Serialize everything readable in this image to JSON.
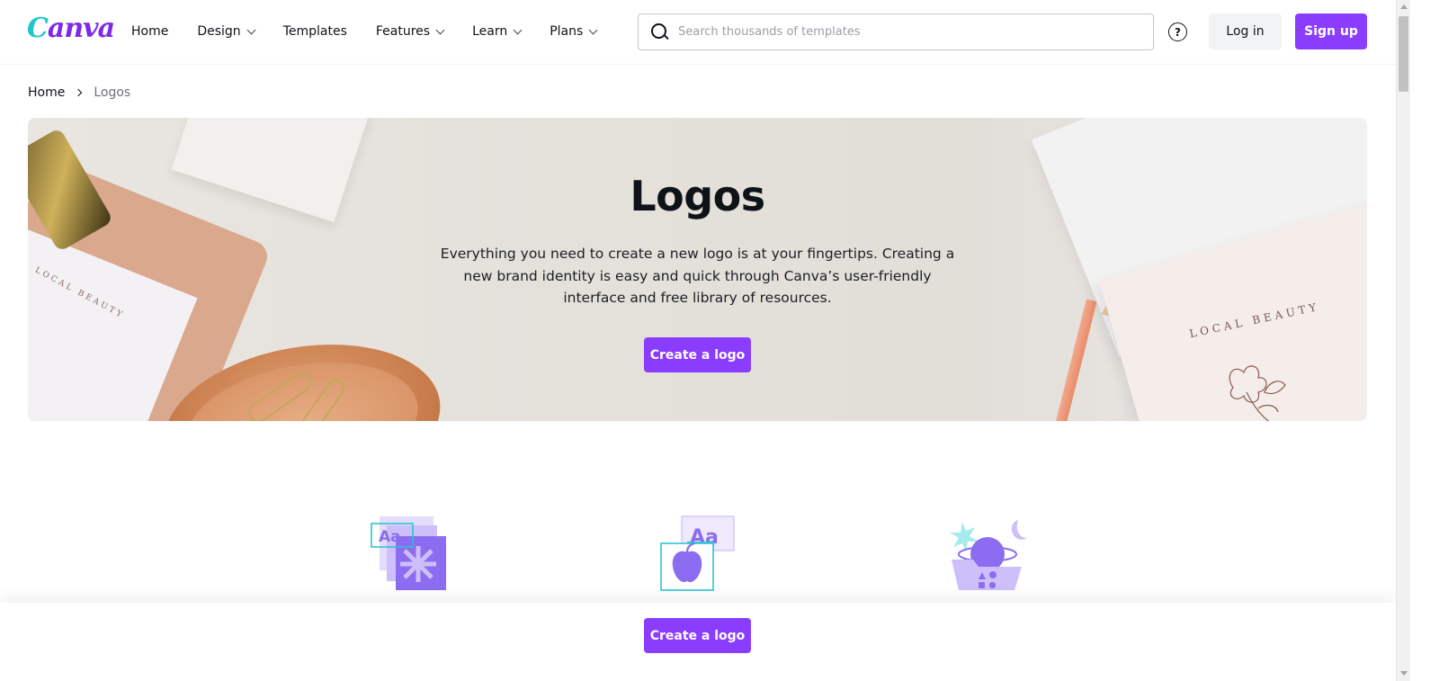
{
  "header": {
    "brand": "Canva",
    "nav": [
      {
        "label": "Home",
        "has_dropdown": false
      },
      {
        "label": "Design",
        "has_dropdown": true
      },
      {
        "label": "Templates",
        "has_dropdown": false
      },
      {
        "label": "Features",
        "has_dropdown": true
      },
      {
        "label": "Learn",
        "has_dropdown": true
      },
      {
        "label": "Plans",
        "has_dropdown": true
      }
    ],
    "search": {
      "placeholder": "Search thousands of templates",
      "value": ""
    },
    "help_glyph": "?",
    "login_label": "Log in",
    "signup_label": "Sign up"
  },
  "breadcrumb": {
    "home": "Home",
    "current": "Logos"
  },
  "hero": {
    "title": "Logos",
    "description": "Everything you need to create a new logo is at your fingertips. Creating a new brand identity is easy and quick through Canva’s user-friendly interface and free library of resources.",
    "cta_label": "Create a logo",
    "emblem_text": "LOCAL BEAUTY",
    "emblem_left_text": "LOCAL BEAUTY"
  },
  "features": {
    "icons": [
      "typography-layers-icon",
      "brand-assets-icon",
      "graphics-folder-icon"
    ],
    "glyph_aa": "Aa"
  },
  "bottom_bar": {
    "cta_label": "Create a logo"
  },
  "colors": {
    "brand_purple": "#8b3dff",
    "brand_teal": "#20c4cb",
    "icon_purple": "#8c6cf0",
    "icon_lavender": "#cdbff9"
  }
}
